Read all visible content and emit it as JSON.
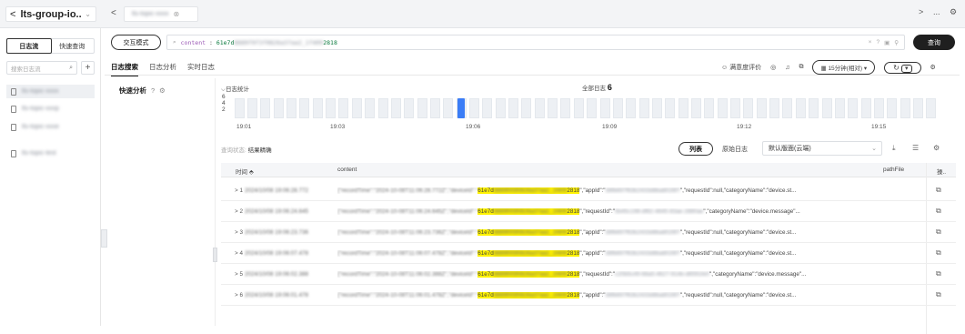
{
  "header": {
    "group_name": "lts-group-io..",
    "tab_label": "lts-topic-xxxx",
    "back_glyph": "<",
    "more_glyph": "...",
    "nav_next_glyph": ">"
  },
  "sidebar": {
    "tabs": [
      "日志流",
      "快速查询"
    ],
    "search_placeholder": "搜索日志流",
    "add_glyph": "+",
    "streams": [
      "lts-topic-xxxx",
      "lts-topic-xxxp",
      "lts-topic-xxxe",
      "lts-topic-test"
    ]
  },
  "query": {
    "mode_label": "交互模式",
    "keyword": "content",
    "operator": ":",
    "value_prefix": "61e7d",
    "value_hidden": "8889f0f3f0826a37aa2_1f409",
    "value_suffix": "2818",
    "search_label": "查询"
  },
  "main_tabs": [
    "日志搜索",
    "日志分析",
    "实时日志"
  ],
  "toolbar": {
    "satisfaction": "满意度评价",
    "time_range": "15分钟(相对)",
    "time_caret": "▾"
  },
  "quick_analysis": {
    "label": "快速分析"
  },
  "histogram": {
    "title": "日志统计",
    "total_label": "全部日志",
    "total": "6",
    "y_ticks": [
      "6",
      "4",
      "2"
    ],
    "x_ticks": [
      "19:01",
      "19:03",
      "19:06",
      "19:09",
      "19:12",
      "19:15"
    ]
  },
  "chart_data": {
    "type": "bar",
    "title": "日志统计",
    "x_ticks": [
      "19:01",
      "19:03",
      "19:06",
      "19:09",
      "19:12",
      "19:15"
    ],
    "ylim": [
      0,
      6
    ],
    "bars": [
      {
        "slot": 17,
        "value": 6
      }
    ],
    "slot_count": 54
  },
  "results": {
    "status_label": "查询状态:",
    "status_value": "结果精确",
    "view_list": "列表",
    "view_raw": "原始日志",
    "layout_select": "默认版面(云端)",
    "columns": {
      "time": "时间",
      "content": "content",
      "pathfile": "pathFile",
      "ops": "操.."
    },
    "rows": [
      {
        "idx": "1",
        "time": "2024/10/08 19:06:28.772",
        "pre": "{\"recordTime\":\"2024-10-08T11:06:28.772Z\",\"deviceId\":\"",
        "mid": "8889f0f3f0826a37aa2_1f409",
        "after": "\",\"appId\":\"",
        "blur2": "38fb697f63b2433d8ba8026f7",
        "tail": "\",\"requestId\":null,\"categoryName\":\"device.st..."
      },
      {
        "idx": "2",
        "time": "2024/10/08 19:06:24.645",
        "pre": "{\"recordTime\":\"2024-10-08T11:06:24.645Z\",\"deviceId\":\"",
        "mid": "8889f0f3f0826a37aa2_1f409",
        "after": "\",\"requestId\":\"",
        "blur2": "5b45c198-df82-4645-83ae-2880ae",
        "tail": "\",\"categoryName\":\"device.message\"..."
      },
      {
        "idx": "3",
        "time": "2024/10/08 19:06:23.736",
        "pre": "{\"recordTime\":\"2024-10-08T11:06:23.736Z\",\"deviceId\":\"",
        "mid": "8889f0f3f0826a37aa2_1f409",
        "after": "\",\"appId\":\"",
        "blur2": "38fb697f63b2433d8ba8026f7",
        "tail": "\",\"requestId\":null,\"categoryName\":\"device.st..."
      },
      {
        "idx": "4",
        "time": "2024/10/08 19:06:07.478",
        "pre": "{\"recordTime\":\"2024-10-08T11:06:07.478Z\",\"deviceId\":\"",
        "mid": "8889f0f3f0826a37aa2_1f409",
        "after": "\",\"appId\":\"",
        "blur2": "38fb697f63b2433d8ba8026f7",
        "tail": "\",\"requestId\":null,\"categoryName\":\"device.st..."
      },
      {
        "idx": "5",
        "time": "2024/10/08 19:06:02.388",
        "pre": "{\"recordTime\":\"2024-10-08T11:06:02.388Z\",\"deviceId\":\"",
        "mid": "8889f0f3f0826a37aa2_1f409",
        "after": "\",\"requestId\":\"",
        "blur2": "c20b5c49-68a5-4627-914b-d6591fe0",
        "tail": "\",\"categoryName\":\"device.message\"..."
      },
      {
        "idx": "6",
        "time": "2024/10/08 19:06:01.478",
        "pre": "{\"recordTime\":\"2024-10-08T11:06:01.478Z\",\"deviceId\":\"",
        "mid": "8889f0f3f0826a37aa2_1f409",
        "after": "\",\"appId\":\"",
        "blur2": "38fb697f63b2433d8ba8026f7",
        "tail": "\",\"requestId\":null,\"categoryName\":\"device.st..."
      }
    ]
  },
  "colors": {
    "accent": "#3b7df6",
    "highlight": "#fff200",
    "dark": "#1f1f1f"
  }
}
